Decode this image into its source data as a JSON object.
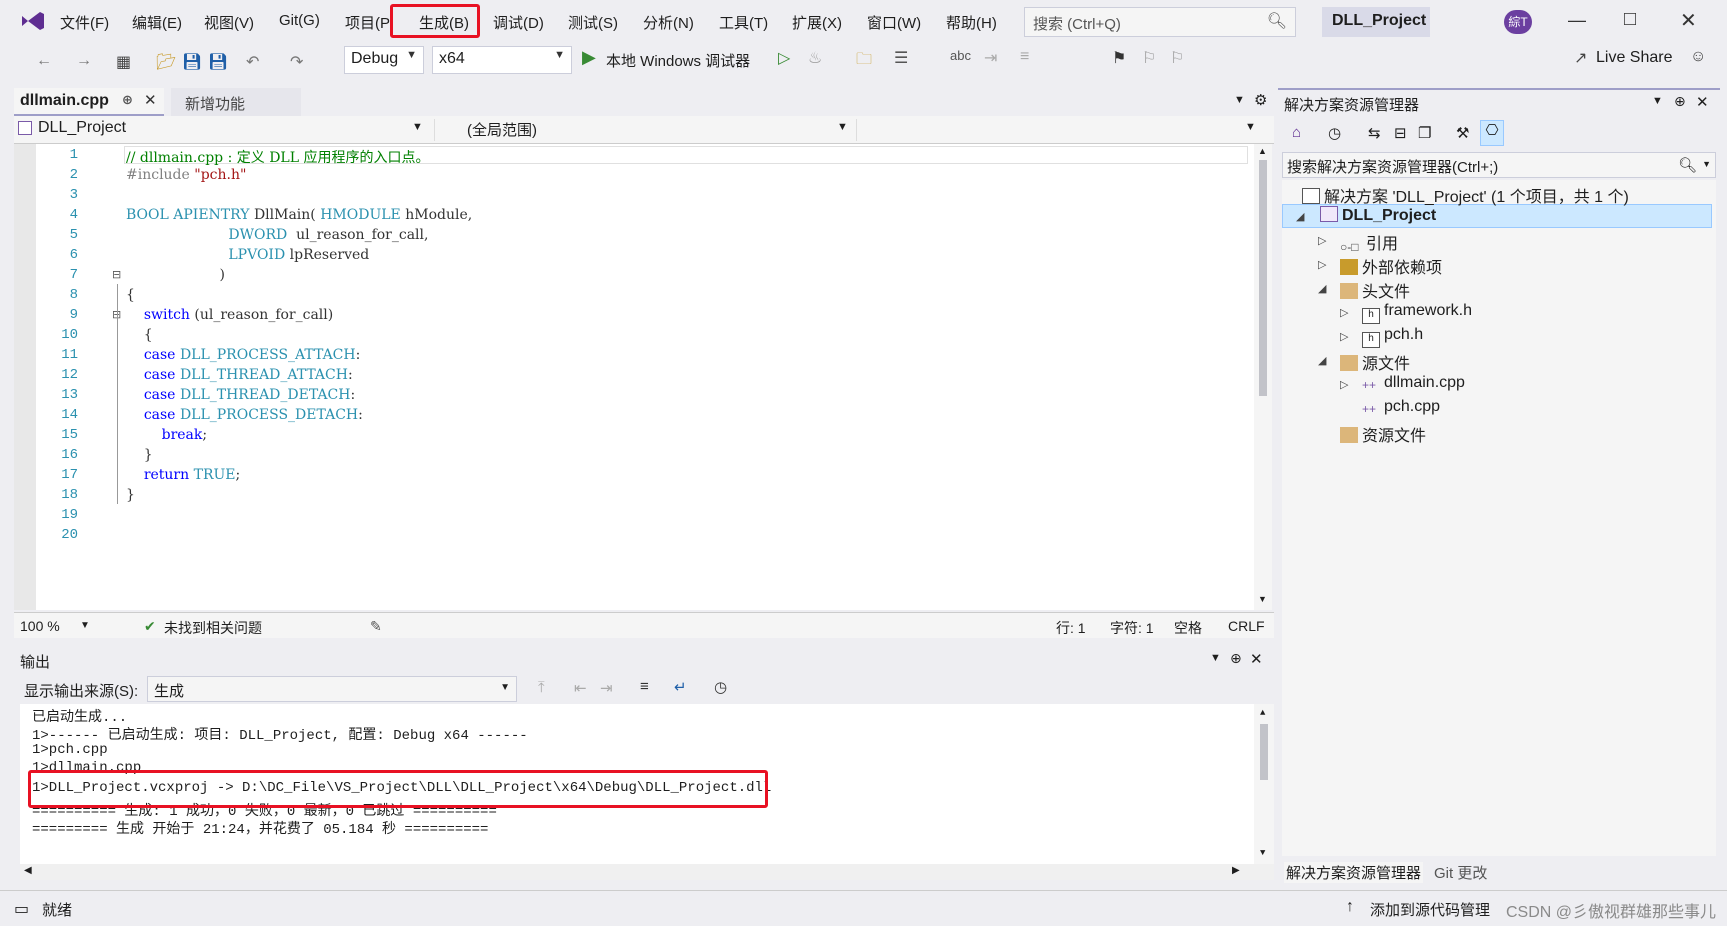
{
  "menubar": {
    "items": [
      "文件(F)",
      "编辑(E)",
      "视图(V)",
      "Git(G)",
      "项目(P",
      "生成(B)",
      "调试(D)",
      "测试(S)",
      "分析(N)",
      "工具(T)",
      "扩展(X)",
      "窗口(W)",
      "帮助(H)"
    ],
    "search_placeholder": "搜索 (Ctrl+Q)",
    "project_title": "DLL_Project",
    "avatar_text": "綜T"
  },
  "toolbar": {
    "config": "Debug",
    "platform": "x64",
    "debugger": "本地 Windows 调试器",
    "live_share": "Live Share"
  },
  "doc_tabs": {
    "active": "dllmain.cpp",
    "other": "新增功能"
  },
  "navbar": {
    "project": "DLL_Project",
    "scope": "(全局范围)"
  },
  "editor": {
    "line_numbers": [
      "1",
      "2",
      "3",
      "4",
      "5",
      "6",
      "7",
      "8",
      "9",
      "10",
      "11",
      "12",
      "13",
      "14",
      "15",
      "16",
      "17",
      "18",
      "19",
      "20"
    ]
  },
  "editor_status": {
    "zoom": "100 %",
    "issues": "未找到相关问题",
    "line": "行: 1",
    "char": "字符: 1",
    "spaces": "空格",
    "eol": "CRLF"
  },
  "output": {
    "title": "输出",
    "source_label": "显示输出来源(S):",
    "source_value": "生成",
    "lines": [
      "已启动生成...",
      "1>------ 已启动生成: 项目: DLL_Project, 配置: Debug x64 ------",
      "1>pch.cpp",
      "1>dllmain.cpp",
      "1>DLL_Project.vcxproj -> D:\\DC_File\\VS_Project\\DLL\\DLL_Project\\x64\\Debug\\DLL_Project.dll",
      "========== 生成: 1 成功，0 失败，0 最新，0 已跳过 ==========",
      "========= 生成 开始于 21:24，并花费了 05.184 秒 =========="
    ]
  },
  "solution_explorer": {
    "title": "解决方案资源管理器",
    "search_placeholder": "搜索解决方案资源管理器(Ctrl+;)",
    "solution": "解决方案 'DLL_Project' (1 个项目，共 1 个)",
    "project": "DLL_Project",
    "nodes": {
      "references": "引用",
      "external_deps": "外部依赖项",
      "headers": "头文件",
      "framework_h": "framework.h",
      "pch_h": "pch.h",
      "sources": "源文件",
      "dllmain_cpp": "dllmain.cpp",
      "pch_cpp": "pch.cpp",
      "resources": "资源文件"
    },
    "bottom_tabs": [
      "解决方案资源管理器",
      "Git 更改"
    ]
  },
  "statusbar": {
    "ready": "就绪",
    "source_control": "添加到源代码管理",
    "watermark": "CSDN @彡傲视群雄那些事儿"
  },
  "colors": {
    "highlight": "#e81123",
    "selection": "#cce8ff",
    "keyword": "#0000ff",
    "comment": "#008000",
    "type": "#2b91af",
    "string": "#a31515"
  }
}
